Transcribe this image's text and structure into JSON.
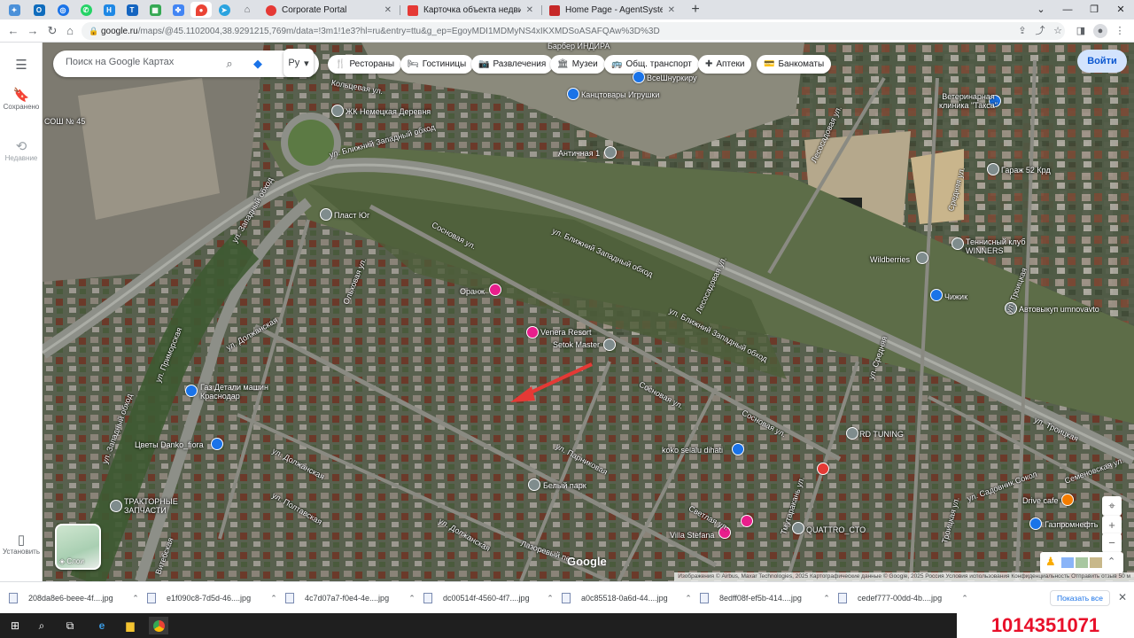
{
  "browser": {
    "pinned_tabs": [
      {
        "icon": "app-icon",
        "color": "#4a90d9"
      },
      {
        "icon": "outlook-icon",
        "color": "#0f6cbd"
      },
      {
        "icon": "circle-app-icon",
        "color": "#1a73e8"
      },
      {
        "icon": "whatsapp-icon",
        "color": "#25d366"
      },
      {
        "icon": "h-app-icon",
        "color": "#1e88e5"
      },
      {
        "icon": "t-app-icon",
        "color": "#1565c0"
      },
      {
        "icon": "map-app-icon",
        "color": "#34a853"
      },
      {
        "icon": "puzzle-app-icon",
        "color": "#4285f4"
      },
      {
        "icon": "google-maps-icon",
        "color": "#ea4335"
      },
      {
        "icon": "telegram-icon",
        "color": "#2aa3df"
      },
      {
        "icon": "house-icon",
        "color": "#5f6368"
      }
    ],
    "tabs": [
      {
        "title": "Corporate Portal",
        "icon_color": "#e53935"
      },
      {
        "title": "Карточка объекта недвижимост",
        "icon_color": "#e53935"
      },
      {
        "title": "Home Page - AgentSystem",
        "icon_color": "#c62828"
      }
    ],
    "url_host": "google.ru",
    "url_path": "/maps/@45.1102004,38.9291215,769m/data=!3m1!1e3?hl=ru&entry=ttu&g_ep=EgoyMDI1MDMyNS4xIKXMDSoASAFQAw%3D%3D"
  },
  "rail": {
    "saved_label": "Сохранено",
    "recent_label": "Недавние",
    "install_label": "Установить"
  },
  "search": {
    "placeholder": "Поиск на Google Картах",
    "lang": "Ру"
  },
  "chips": [
    {
      "icon": "fork-knife-icon",
      "glyph": "🍴",
      "label": "Рестораны"
    },
    {
      "icon": "bed-icon",
      "glyph": "🛏",
      "label": "Гостиницы"
    },
    {
      "icon": "camera-icon",
      "glyph": "📷",
      "label": "Развлечения"
    },
    {
      "icon": "museum-icon",
      "glyph": "🏛",
      "label": "Музеи"
    },
    {
      "icon": "bus-icon",
      "glyph": "🚌",
      "label": "Общ. транспорт"
    },
    {
      "icon": "pharmacy-icon",
      "glyph": "✚",
      "label": "Аптеки"
    },
    {
      "icon": "atm-icon",
      "glyph": "💳",
      "label": "Банкоматы"
    }
  ],
  "signin_label": "Войти",
  "places": [
    {
      "name": "Барбер ИНДИРА"
    },
    {
      "name": "ВсеШнуркиру"
    },
    {
      "name": "Канцтовары Игрушки"
    },
    {
      "name": "ЖК Немецкая Деревня"
    },
    {
      "name": "СОШ № 45"
    },
    {
      "name": "Античная 1"
    },
    {
      "name": "Ветеринарная клиника \"Такса\""
    },
    {
      "name": "Гараж 52 Крд"
    },
    {
      "name": "Пласт Юг"
    },
    {
      "name": "Wildberries"
    },
    {
      "name": "Теннисный клуб WINNERS"
    },
    {
      "name": "Чижик"
    },
    {
      "name": "Оранж"
    },
    {
      "name": "Автовыкуп umnovavto"
    },
    {
      "name": "Venera Resort"
    },
    {
      "name": "Setok Master"
    },
    {
      "name": "Газ Детали машин Краснодар"
    },
    {
      "name": "RD TUNING"
    },
    {
      "name": "Цветы Danko_fiora"
    },
    {
      "name": "koko selalu dihati"
    },
    {
      "name": "Белый парк"
    },
    {
      "name": "Drive cafe"
    },
    {
      "name": "ТРАКТОРНЫЕ ЗАПЧАСТИ"
    },
    {
      "name": "Газпромнефть"
    },
    {
      "name": "QUATTRO_CTO"
    },
    {
      "name": "Villa Stefana"
    }
  ],
  "roads": [
    {
      "name": "ул. Ближний Западный обход"
    },
    {
      "name": "ул. Ближний Западный обход"
    },
    {
      "name": "ул. Ближний Западный обход"
    },
    {
      "name": "ул. Западный обход"
    },
    {
      "name": "ул. Западный обход"
    },
    {
      "name": "Сосновая ул."
    },
    {
      "name": "Сосновая ул."
    },
    {
      "name": "Сосновая ул."
    },
    {
      "name": "ул. Должанская"
    },
    {
      "name": "ул. Должанская"
    },
    {
      "name": "ул. Должанская"
    },
    {
      "name": "ул. Троицкая"
    },
    {
      "name": "ул. Троицкая"
    },
    {
      "name": "Троицкая ул."
    },
    {
      "name": "Лесосадовая ул."
    },
    {
      "name": "Лесосадовая ул."
    },
    {
      "name": "ул. Средняя"
    },
    {
      "name": "Средняя ул."
    },
    {
      "name": "Семеновская ул."
    },
    {
      "name": "Лазоревый пер."
    },
    {
      "name": "ул. Приморская"
    },
    {
      "name": "Витебская"
    },
    {
      "name": "ул. Полтавская"
    },
    {
      "name": "Кольцевая ул."
    },
    {
      "name": "Ольховая ул."
    },
    {
      "name": "ул. Парниковая"
    },
    {
      "name": "Тмутаракань ул."
    },
    {
      "name": "Светлая ул."
    },
    {
      "name": "ул. Садовник Сокол"
    }
  ],
  "layers_label": "Слои",
  "google_logo": "Google",
  "attribution": "Изображения © Airbus, Maxar Technologies, 2025 Картографические данные © Google, 2025   Россия   Условия использования   Конфиденциальность   Отправить отзыв   50 м",
  "downloads": [
    {
      "name": "208da8e6-beee-4f....jpg"
    },
    {
      "name": "e1f090c8-7d5d-46....jpg"
    },
    {
      "name": "4c7d07a7-f0e4-4e....jpg"
    },
    {
      "name": "dc00514f-4560-4f7....jpg"
    },
    {
      "name": "a0c85518-0a6d-44....jpg"
    },
    {
      "name": "8edff08f-ef5b-414....jpg"
    },
    {
      "name": "cedef777-00dd-4b....jpg"
    }
  ],
  "show_all_label": "Показать все",
  "overlay_number": "1014351071"
}
